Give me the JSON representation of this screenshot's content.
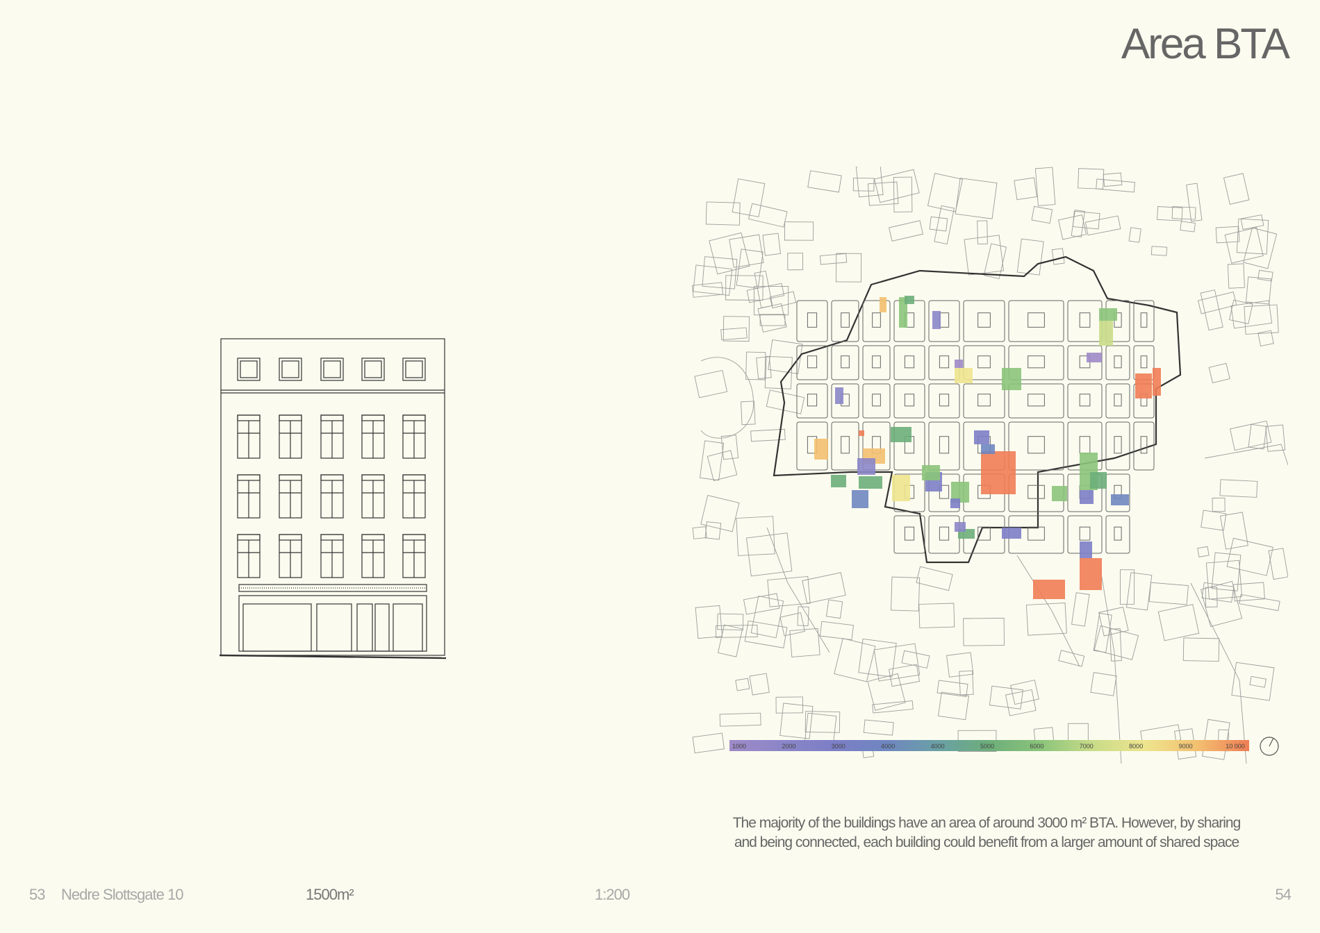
{
  "page": {
    "title": "Area BTA",
    "left_page_number": "53",
    "building_name": "Nedre Slottsgate 10",
    "building_area": "1500m²",
    "scale": "1:200",
    "right_page_number": "54"
  },
  "caption": {
    "line1": "The majority of the buildings have an area of around 3000 m² BTA. However, by sharing",
    "line2": "and being connected, each building could benefit from a larger amount of shared space"
  },
  "legend": {
    "ticks": [
      "1000",
      "2000",
      "3000",
      "4000",
      "4000",
      "5000",
      "6000",
      "7000",
      "8000",
      "9000",
      "10 000"
    ],
    "colors": [
      "#9f8ac8",
      "#8b86c8",
      "#7c7ec6",
      "#6f86c0",
      "#6aa0a6",
      "#6dae7a",
      "#8bc47a",
      "#c9dc88",
      "#eee48e",
      "#f3c070",
      "#ef7d55"
    ]
  },
  "colors": {
    "background": "#fbfcef",
    "line": "#3a3a3a",
    "faint_line": "#9a9a9a"
  }
}
